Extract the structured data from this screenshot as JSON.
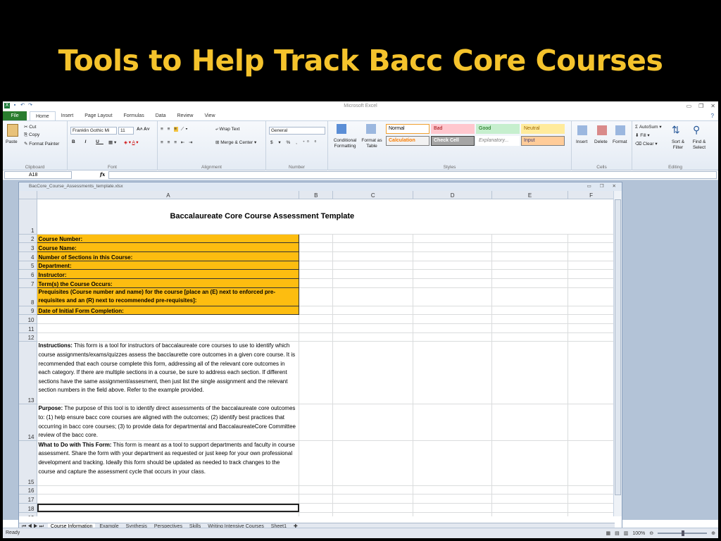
{
  "slide": {
    "title": "Tools to Help Track Bacc Core Courses"
  },
  "window": {
    "title": "Microsoft Excel",
    "workbook_title": "BacCore_Course_Assessments_template.xlsx"
  },
  "ribbon_tabs": [
    "File",
    "Home",
    "Insert",
    "Page Layout",
    "Formulas",
    "Data",
    "Review",
    "View"
  ],
  "clipboard": {
    "paste": "Paste",
    "cut": "Cut",
    "copy": "Copy",
    "format_painter": "Format Painter",
    "label": "Clipboard"
  },
  "font": {
    "name": "Franklin Gothic Mi",
    "size": "11",
    "label": "Font"
  },
  "alignment": {
    "wrap": "Wrap Text",
    "merge": "Merge & Center",
    "label": "Alignment"
  },
  "number": {
    "format": "General",
    "label": "Number"
  },
  "styles": {
    "conditional": "Conditional Formatting",
    "format_table": "Format as Table",
    "label": "Styles",
    "cells": [
      {
        "name": "Normal",
        "bg": "#ffffff",
        "fg": "#000000",
        "border": "#f0a030"
      },
      {
        "name": "Bad",
        "bg": "#ffc7ce",
        "fg": "#9c0006"
      },
      {
        "name": "Good",
        "bg": "#c6efce",
        "fg": "#006100"
      },
      {
        "name": "Neutral",
        "bg": "#ffeb9c",
        "fg": "#9c6500"
      },
      {
        "name": "Calculation",
        "bg": "#f2f2f2",
        "fg": "#fa7d00",
        "border": "#7f7f7f"
      },
      {
        "name": "Check Cell",
        "bg": "#a5a5a5",
        "fg": "#ffffff",
        "border": "#3f3f3f"
      },
      {
        "name": "Explanatory...",
        "bg": "#ffffff",
        "fg": "#7f7f7f"
      },
      {
        "name": "Input",
        "bg": "#ffcc99",
        "fg": "#3f3f76",
        "border": "#7f7f7f"
      }
    ]
  },
  "cells_group": {
    "insert": "Insert",
    "delete": "Delete",
    "format": "Format",
    "label": "Cells"
  },
  "editing": {
    "autosum": "AutoSum",
    "fill": "Fill",
    "clear": "Clear",
    "sort": "Sort & Filter",
    "find": "Find & Select",
    "label": "Editing"
  },
  "formula_bar": {
    "name_box": "A18",
    "fx": "fx",
    "value": ""
  },
  "columns": [
    "A",
    "B",
    "C",
    "D",
    "E",
    "F"
  ],
  "rows": {
    "r1": "Baccalaureate Core Course Assessment Template",
    "r2": "Course Number:",
    "r3": "Course Name:",
    "r4": "Number of Sections in this Course:",
    "r5": "Department:",
    "r6": "Instructor:",
    "r7": "Term(s) the Course Occurs:",
    "r8": "Prequisites (Course number and name) for the course [place an (E) next to enforced pre-requisites and an (R) next to recommended pre-requisites]:",
    "r9": "Date of Initial Form Completion:",
    "r13_label": "Instructions:",
    "r13": "This form is a tool for instructors of baccalaureate core courses to use to identify which course assignments/exams/quizzes assess the bacclaurette core outcomes in a given core course. It is recommended that each course complete this form, addressing all of the relevant core outcomes in each category. If there are multiple sections in a course, be sure to address each section. If different sections have the same assignment/assesment, then just list the single assignment and the relevant section numbers in the field above. Refer to the example provided.",
    "r14_label": "Purpose:",
    "r14": "The purpose of this tool is to identify direct assessments of the baccalaureate core outcomes to: (1) help ensure bacc core courses are aligned with the outcomes; (2) identify best practices that occurring in bacc core courses; (3) to provide data for departmental and BaccalaureateCore Committee review of the bacc core.",
    "r15_label": "What to Do with This Form:",
    "r15": "This form is meant as a tool to support departments and faculty in course assessment. Share the form with your department as requested or just keep for your own professional development and tracking. Ideally this form should be updated as needed to track changes to the course and capture the assessment cycle that occurs in your class."
  },
  "row_numbers": [
    "1",
    "2",
    "3",
    "4",
    "5",
    "6",
    "7",
    "8",
    "9",
    "10",
    "11",
    "12",
    "13",
    "14",
    "15",
    "16",
    "17",
    "18",
    "19"
  ],
  "sheet_tabs": [
    "Course Information",
    "Example",
    "Synthesis",
    "Perspectives",
    "Skills",
    "Writing Intensive Courses",
    "Sheet1"
  ],
  "status": {
    "ready": "Ready",
    "zoom": "100%"
  }
}
